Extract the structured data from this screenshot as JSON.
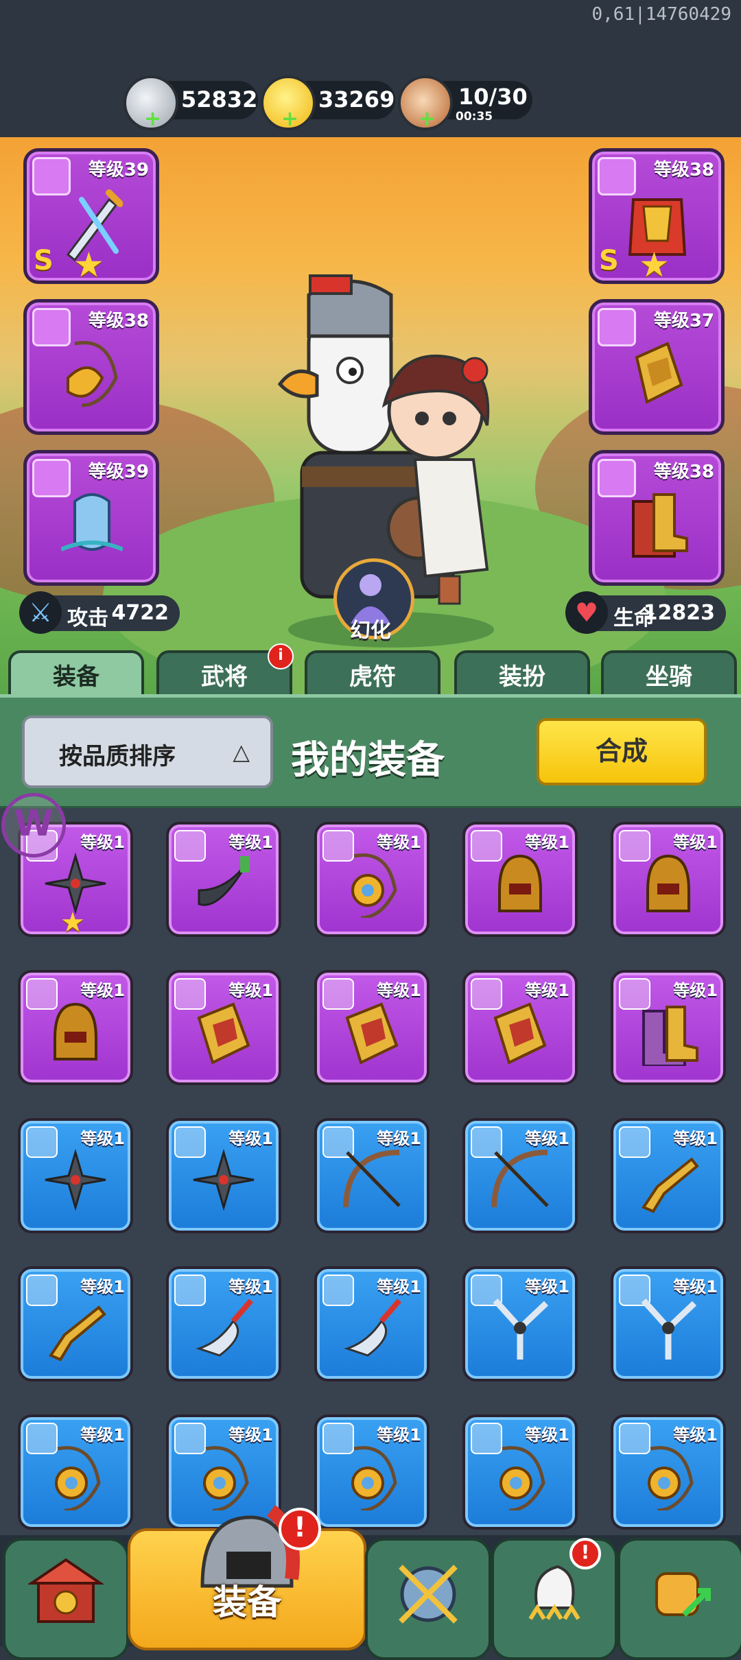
{
  "build_id": "0,61|14760429",
  "resources": [
    {
      "name": "silver",
      "value": "52832",
      "icon": "silver-coin-icon"
    },
    {
      "name": "gold",
      "value": "33269",
      "icon": "gold-ingot-icon"
    },
    {
      "name": "stamina",
      "value": "10/30",
      "timer": "00:35",
      "icon": "meat-drumstick-icon"
    }
  ],
  "equipped": {
    "left": [
      {
        "level": "等级39",
        "grade": "S",
        "icon": "sword-icon"
      },
      {
        "level": "等级38",
        "icon": "amulet-icon"
      },
      {
        "level": "等级39",
        "icon": "helmet-icon"
      }
    ],
    "right": [
      {
        "level": "等级38",
        "grade": "S",
        "icon": "armor-icon"
      },
      {
        "level": "等级37",
        "icon": "gauntlet-icon"
      },
      {
        "level": "等级38",
        "icon": "boots-icon"
      }
    ]
  },
  "stats": {
    "attack_label": "攻击",
    "attack_value": "4722",
    "hp_label": "生命",
    "hp_value": "12823"
  },
  "morph_label": "幻化",
  "tabs": [
    "装备",
    "武将",
    "虎符",
    "装扮",
    "坐骑"
  ],
  "tab_badge": "i",
  "panel": {
    "sort_label": "按品质排序",
    "title": "我的装备",
    "merge_label": "合成"
  },
  "inventory": [
    {
      "rarity": "purple",
      "level": "等级1",
      "icon": "shuriken-icon",
      "star": true
    },
    {
      "rarity": "purple",
      "level": "等级1",
      "icon": "dagger-icon"
    },
    {
      "rarity": "purple",
      "level": "等级1",
      "icon": "amulet-icon"
    },
    {
      "rarity": "purple",
      "level": "等级1",
      "icon": "helmet-icon"
    },
    {
      "rarity": "purple",
      "level": "等级1",
      "icon": "helmet-icon"
    },
    {
      "rarity": "purple",
      "level": "等级1",
      "icon": "helmet-icon"
    },
    {
      "rarity": "purple",
      "level": "等级1",
      "icon": "gauntlet-icon"
    },
    {
      "rarity": "purple",
      "level": "等级1",
      "icon": "gauntlet-icon"
    },
    {
      "rarity": "purple",
      "level": "等级1",
      "icon": "gauntlet-icon"
    },
    {
      "rarity": "purple",
      "level": "等级1",
      "icon": "boots-icon"
    },
    {
      "rarity": "blue",
      "level": "等级1",
      "icon": "shuriken-icon"
    },
    {
      "rarity": "blue",
      "level": "等级1",
      "icon": "shuriken-icon"
    },
    {
      "rarity": "blue",
      "level": "等级1",
      "icon": "crossbow-icon"
    },
    {
      "rarity": "blue",
      "level": "等级1",
      "icon": "crossbow-icon"
    },
    {
      "rarity": "blue",
      "level": "等级1",
      "icon": "golden-gun-icon"
    },
    {
      "rarity": "blue",
      "level": "等级1",
      "icon": "golden-gun-icon"
    },
    {
      "rarity": "blue",
      "level": "等级1",
      "icon": "glaive-icon"
    },
    {
      "rarity": "blue",
      "level": "等级1",
      "icon": "glaive-icon"
    },
    {
      "rarity": "blue",
      "level": "等级1",
      "icon": "triple-blade-icon"
    },
    {
      "rarity": "blue",
      "level": "等级1",
      "icon": "triple-blade-icon"
    },
    {
      "rarity": "blue",
      "level": "等级1",
      "icon": "amulet-icon"
    },
    {
      "rarity": "blue",
      "level": "等级1",
      "icon": "amulet-icon"
    },
    {
      "rarity": "blue",
      "level": "等级1",
      "icon": "amulet-icon"
    },
    {
      "rarity": "blue",
      "level": "等级1",
      "icon": "amulet-icon"
    },
    {
      "rarity": "blue",
      "level": "等级1",
      "icon": "amulet-icon"
    }
  ],
  "nav": [
    {
      "icon": "city-gate-icon"
    },
    {
      "label": "装备",
      "icon": "equipment-helmet-icon",
      "alert": "!"
    },
    {
      "icon": "shield-swords-icon"
    },
    {
      "icon": "goose-rank-icon",
      "alert": "!"
    },
    {
      "icon": "fist-upgrade-icon"
    }
  ],
  "colors": {
    "purple": "#a034cf",
    "blue": "#1c7cd9",
    "green_panel": "#4a8862",
    "yellow_button": "#f6c40b",
    "alert_red": "#e0231c"
  }
}
